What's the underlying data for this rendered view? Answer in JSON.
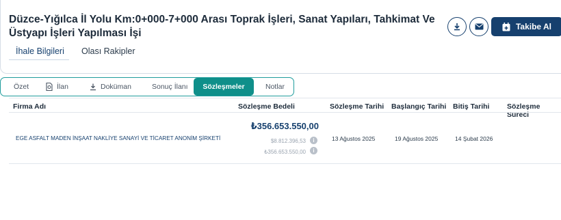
{
  "header": {
    "title": "Düzce-Yığılca İl Yolu Km:0+000-7+000 Arası Toprak İşleri, Sanat Yapıları, Tahkimat Ve Üstyapı İşleri Yapılması İşi",
    "follow_label": "Takibe Al",
    "icons": [
      "download-icon",
      "mail-icon",
      "calendar-plus-icon"
    ]
  },
  "subtabs": [
    {
      "label": "İhale Bilgileri",
      "active": true
    },
    {
      "label": "Olası Rakipler",
      "active": false
    }
  ],
  "tabs": [
    {
      "label": "Özet",
      "icon": null
    },
    {
      "label": "İlan",
      "icon": "document-icon"
    },
    {
      "label": "Doküman",
      "icon": "download-icon"
    },
    {
      "label": "Sonuç İlanı",
      "icon": null
    },
    {
      "label": "Sözleşmeler",
      "icon": null,
      "active": true
    },
    {
      "label": "Notlar",
      "icon": null
    }
  ],
  "table": {
    "columns": [
      "Firma Adı",
      "Sözleşme Bedeli",
      "Sözleşme Tarihi",
      "Başlangıç Tarihi",
      "Bitiş Tarihi",
      "Sözleşme Süreci"
    ],
    "rows": [
      {
        "firm": "EGE ASFALT MADEN İNŞAAT NAKLİYE SANAYİ VE TİCARET ANONİM ŞİRKETİ",
        "amount": "₺356.653.550,00",
        "amount_usd": "$8.812.396,53",
        "amount_sub": "₺356.653.550,00",
        "contract_date": "13 Ağustos 2025",
        "start_date": "19 Ağustos 2025",
        "end_date": "14 Şubat 2026",
        "process": ""
      }
    ]
  },
  "colors": {
    "primary": "#16406e",
    "teal": "#0f8f8a",
    "border": "#d6dde6"
  }
}
